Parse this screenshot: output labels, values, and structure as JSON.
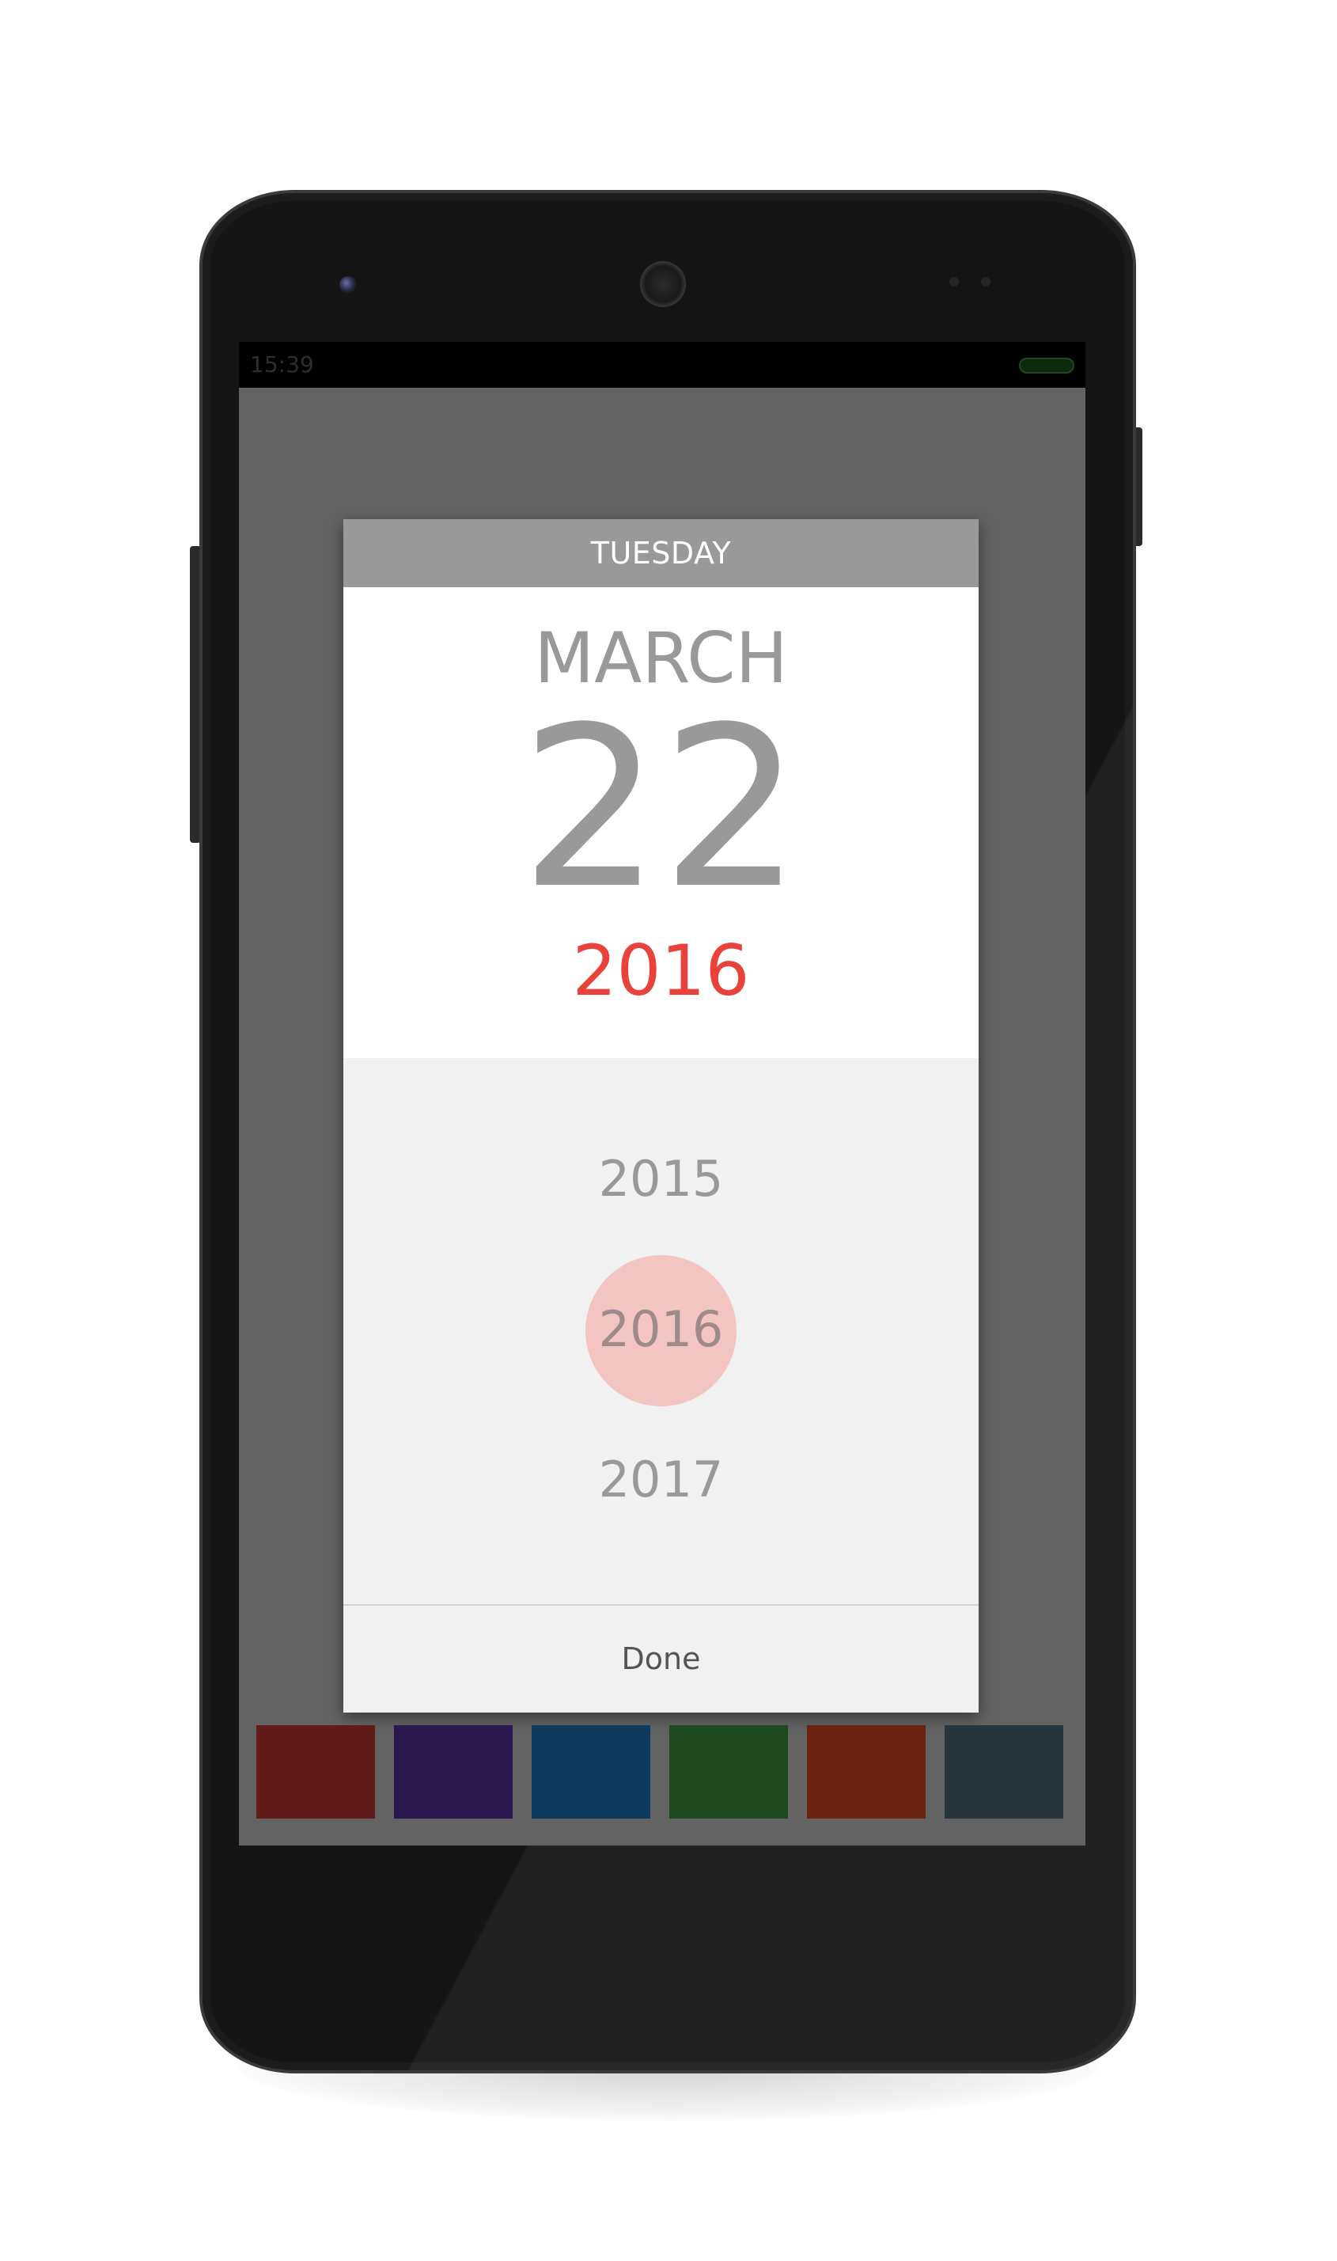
{
  "status_bar": {
    "time": "15:39"
  },
  "dialog": {
    "day_of_week": "TUESDAY",
    "month": "MARCH",
    "day": "22",
    "year": "2016",
    "year_list": {
      "previous": "2015",
      "selected": "2016",
      "next": "2017"
    },
    "done_label": "Done"
  },
  "colors": {
    "accent": "#e8423b",
    "highlight": "#f2c5c3",
    "header_bg": "#999999",
    "scrim": "#636363"
  },
  "color_swatches": [
    {
      "color": "#621a1a"
    },
    {
      "color": "#2a184e"
    },
    {
      "color": "#0e3a5e"
    },
    {
      "color": "#1f4a20"
    },
    {
      "color": "#6a2410"
    },
    {
      "color": "#28353c"
    }
  ]
}
